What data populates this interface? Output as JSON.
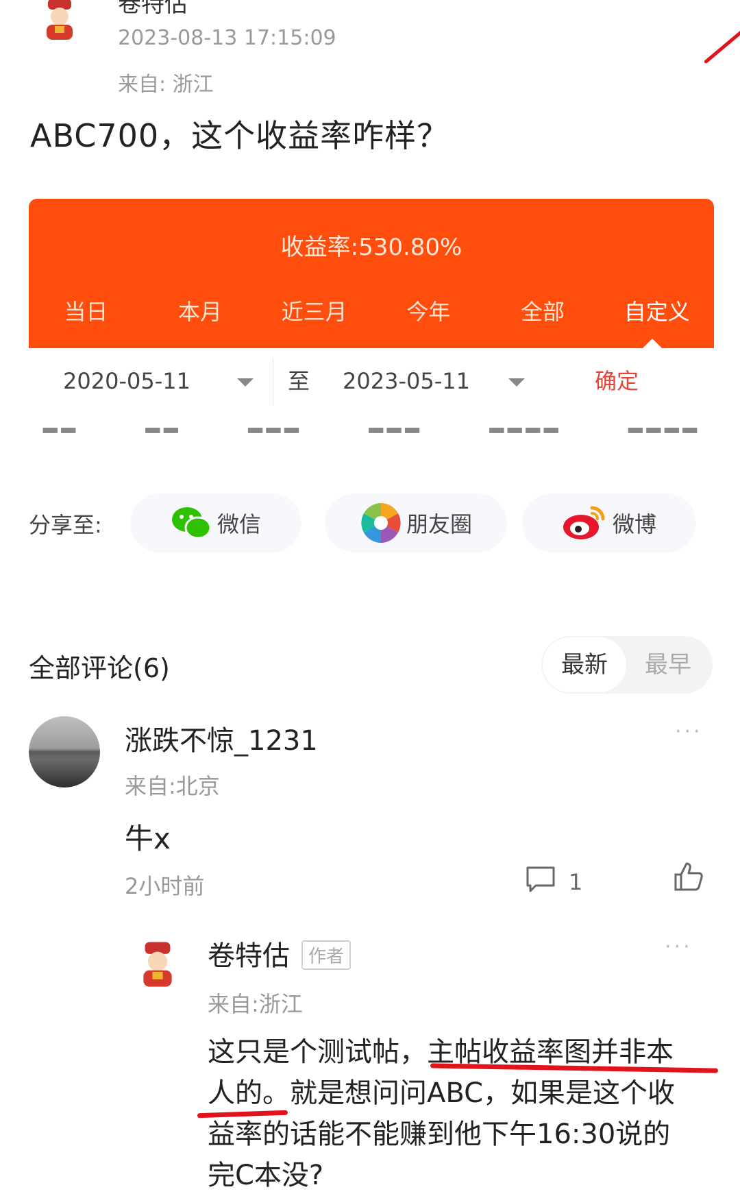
{
  "post": {
    "author": "卷特估",
    "timestamp": "2023-08-13 17:15:09",
    "location": "来自: 浙江",
    "title": "ABC700，这个收益率咋样？"
  },
  "card": {
    "return_label": "收益率:530.80%",
    "tabs": [
      "当日",
      "本月",
      "近三月",
      "今年",
      "全部",
      "自定义"
    ],
    "selected_tab": "自定义",
    "accent_color": "#ff4d0d"
  },
  "date_range": {
    "start": "2020-05-11",
    "separator": "至",
    "end": "2023-05-11",
    "confirm": "确定"
  },
  "share": {
    "label": "分享至:",
    "targets": [
      {
        "label": "微信",
        "icon": "wechat-icon"
      },
      {
        "label": "朋友圈",
        "icon": "moments-icon"
      },
      {
        "label": "微博",
        "icon": "weibo-icon"
      }
    ]
  },
  "comments": {
    "title": "全部评论(6)",
    "sort_new": "最新",
    "sort_old": "最早",
    "items": [
      {
        "user": "涨跌不惊_1231",
        "location": "来自:北京",
        "text": "牛x",
        "time": "2小时前",
        "reply_count": "1",
        "more": "···",
        "reply": {
          "user": "卷特估",
          "badge": "作者",
          "location": "来自:浙江",
          "more": "···",
          "text_line1_a": "这只是个测试帖，",
          "text_line1_b": "主帖收益率图并非本",
          "text_line2_a": "人的。",
          "text_line2_b": "就是想问问ABC，如果是这个收",
          "text_line3": "益率的话能不能赚到他下午16:30说的",
          "text_line4": "完C本没?"
        }
      }
    ]
  }
}
